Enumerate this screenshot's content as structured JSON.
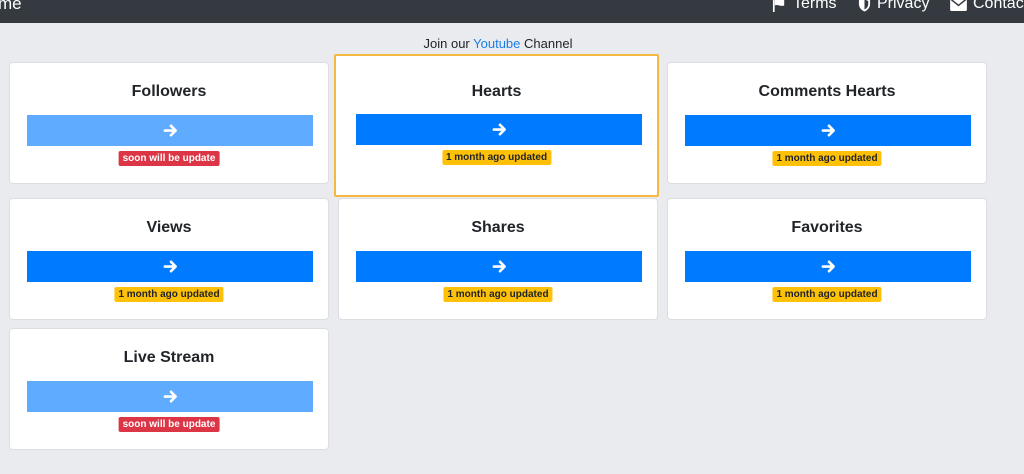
{
  "nav": {
    "brand": "me",
    "terms": "Terms",
    "privacy": "Privacy",
    "contact": "Contac"
  },
  "join": {
    "prefix": "Join our",
    "link": "Youtube",
    "suffix": "Channel"
  },
  "cards": [
    {
      "title": "Followers",
      "badge": "soon will be update",
      "badge_type": "danger",
      "button_style": "light"
    },
    {
      "title": "Hearts",
      "badge": "1 month ago updated",
      "badge_type": "warning",
      "button_style": "primary",
      "highlighted": true
    },
    {
      "title": "Comments Hearts",
      "badge": "1 month ago updated",
      "badge_type": "warning",
      "button_style": "primary"
    },
    {
      "title": "Views",
      "badge": "1 month ago updated",
      "badge_type": "warning",
      "button_style": "primary"
    },
    {
      "title": "Shares",
      "badge": "1 month ago updated",
      "badge_type": "warning",
      "button_style": "primary"
    },
    {
      "title": "Favorites",
      "badge": "1 month ago updated",
      "badge_type": "warning",
      "button_style": "primary"
    },
    {
      "title": "Live Stream",
      "badge": "soon will be update",
      "badge_type": "danger",
      "button_style": "light"
    }
  ],
  "colors": {
    "primary_button": "#007bff",
    "light_button": "#5eabff",
    "warning_badge": "#ffc107",
    "danger_badge": "#dc3545",
    "highlight_border": "#f5b841",
    "topbar": "#343a40",
    "page_background": "#e9ebee"
  },
  "icons": {
    "button": "arrow-right-icon",
    "terms": "flag-icon",
    "privacy": "shield-icon",
    "contact": "envelope-icon"
  }
}
